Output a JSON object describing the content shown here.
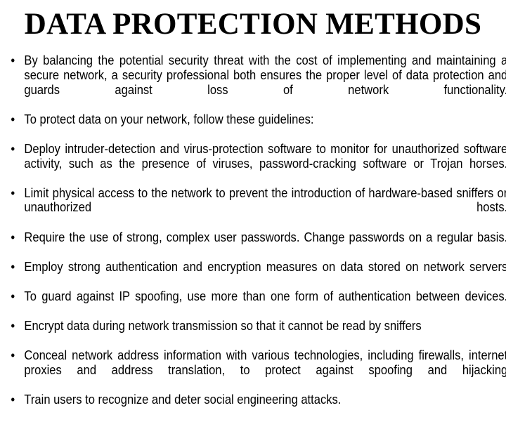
{
  "slide": {
    "title": "DATA PROTECTION METHODS",
    "background_color": "#ffffff",
    "text_color": "#000000",
    "bullet_marker": "•",
    "bullets": [
      {
        "text": "By balancing the potential security threat with the cost of implementing and maintaining a secure network, a security professional both ensures the proper level of data protection and guards against loss of network functionality.",
        "justified": true
      },
      {
        "text": "To protect data on your network, follow these guidelines:",
        "justified": false
      },
      {
        "text": "Deploy intruder-detection and virus-protection software to monitor for unauthorized software activity, such as the presence of viruses, password-cracking software or Trojan horses.",
        "justified": true
      },
      {
        "text": "Limit physical access to the network to prevent the introduction of hardware-based sniffers or unauthorized hosts.",
        "justified": true
      },
      {
        "text": "Require the use of strong, complex user passwords. Change passwords on a regular basis.",
        "justified": true
      },
      {
        "text": "Employ strong authentication and encryption measures on data stored on network servers",
        "justified": true
      },
      {
        "text": "To guard against IP spoofing, use more than one form of authentication between devices.",
        "justified": true
      },
      {
        "text": "Encrypt data during network transmission so that it cannot be read by sniffers",
        "justified": false
      },
      {
        "text": "Conceal network address information with various technologies, including firewalls, internet proxies and address translation, to protect against spoofing and hijacking",
        "justified": true
      },
      {
        "text": "Train users to recognize and deter social engineering attacks.",
        "justified": false
      }
    ]
  }
}
